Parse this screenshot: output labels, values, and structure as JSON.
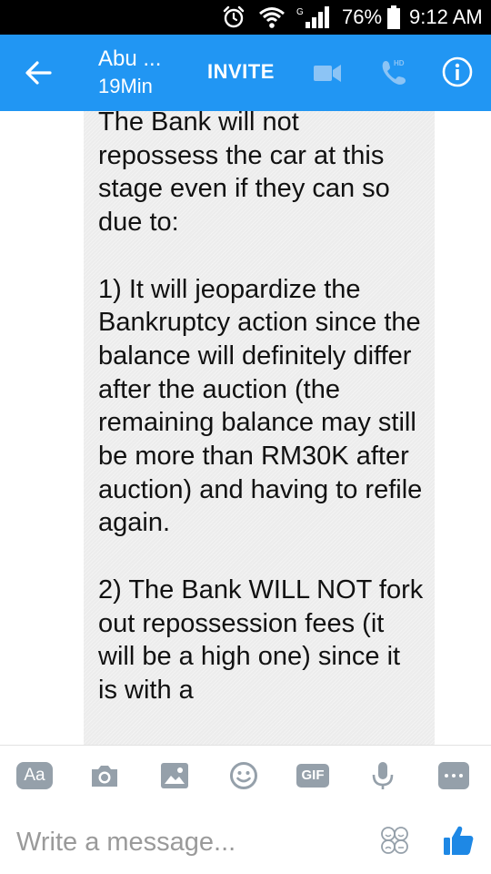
{
  "status_bar": {
    "network_label": "G",
    "battery_text": "76%",
    "time": "9:12 AM",
    "icons": [
      "alarm-icon",
      "wifi-icon",
      "signal-icon",
      "battery-icon"
    ]
  },
  "header": {
    "back_icon": "arrow-left-icon",
    "contact_name": "Abu ...",
    "contact_status": "19Min",
    "invite_label": "INVITE",
    "video_icon": "video-camera-icon",
    "call_icon": "phone-hd-icon",
    "call_badge": "HD",
    "info_icon": "info-icon",
    "colors": {
      "bar": "#2196f3",
      "text": "#ffffff"
    }
  },
  "conversation": {
    "message_text": "The Bank will not repossess the car at this stage even if they can so due to:\n\n1) It will jeopardize the Bankruptcy action since the balance will definitely differ after the auction (the remaining balance may still be more than RM30K after auction) and having to refile again.\n\n2) The Bank WILL NOT fork out repossession fees (it will be a high one) since it is with a"
  },
  "composer": {
    "aa_label": "Aa",
    "gif_label": "GIF",
    "tool_icons": [
      "text-format-icon",
      "camera-icon",
      "photo-icon",
      "emoji-icon",
      "gif-icon",
      "microphone-icon",
      "more-icon"
    ],
    "placeholder": "Write a message...",
    "sticker_icon": "sticker-icon",
    "like_icon": "thumbs-up-icon",
    "colors": {
      "tool": "#95a0aa",
      "like": "#1e88e5"
    }
  }
}
